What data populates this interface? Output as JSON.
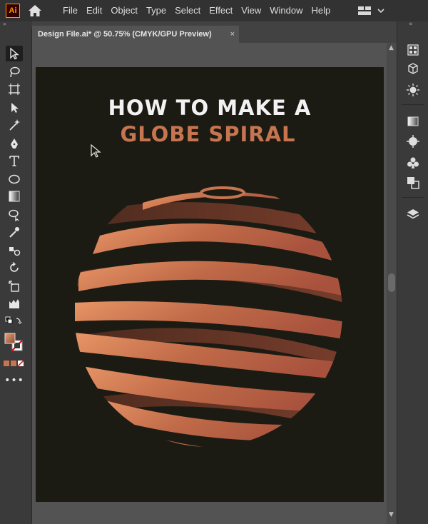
{
  "app": {
    "logo_text": "Ai"
  },
  "menu": [
    "File",
    "Edit",
    "Object",
    "Type",
    "Select",
    "Effect",
    "View",
    "Window",
    "Help"
  ],
  "document_tab": {
    "title": "Design File.ai* @ 50.75% (CMYK/GPU Preview)",
    "close": "×"
  },
  "artwork": {
    "line1": "HOW TO MAKE A",
    "line2": "GLOBE SPIRAL"
  },
  "toolbar": {
    "tools": [
      "selection-tool",
      "direct-selection-tool",
      "artboard-tool",
      "pen-tool",
      "curvature-tool",
      "pencil-tool",
      "type-tool",
      "ellipse-tool",
      "gradient-tool",
      "shape-builder-tool",
      "eyedropper-tool",
      "blend-tool",
      "rotate-tool",
      "scale-tool",
      "perspective-tool",
      "swap-colors",
      "fill-stroke",
      "color-mode",
      "more-tools"
    ]
  },
  "colors": {
    "accent": "#c67550",
    "artboard": "#1c1b13",
    "chrome": "#323232",
    "panel": "#3a3a3a"
  }
}
